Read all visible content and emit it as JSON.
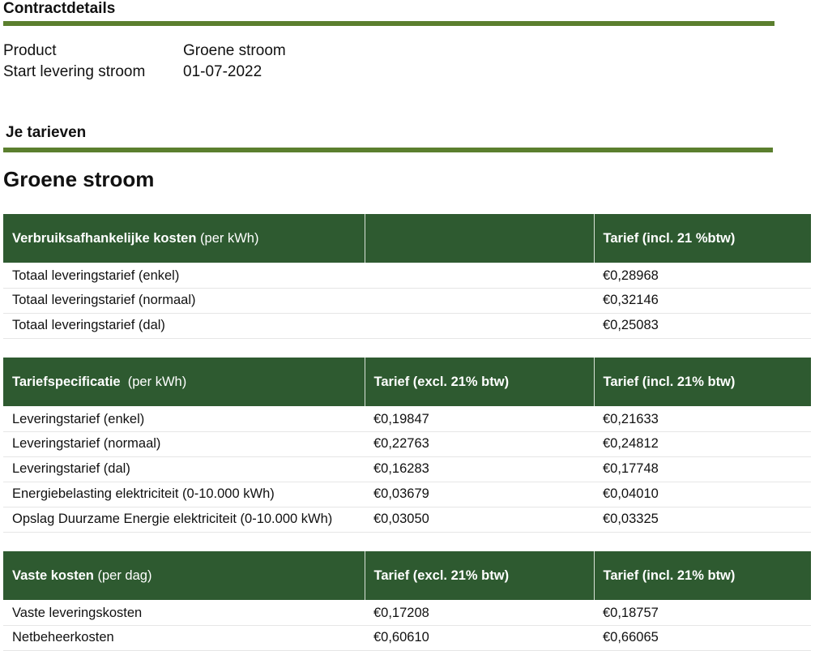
{
  "contract": {
    "title": "Contractdetails",
    "rows": [
      {
        "label": "Product",
        "value": "Groene stroom"
      },
      {
        "label": "Start levering stroom",
        "value": "01-07-2022"
      }
    ]
  },
  "tariffs": {
    "title": "Je tarieven",
    "product_title": "Groene stroom"
  },
  "usage_table": {
    "header_label": "Verbruiksafhankelijke kosten",
    "header_unit": "(per kWh)",
    "col2": "",
    "col3": "Tarief (incl. 21 %btw)",
    "rows": [
      {
        "label": "Totaal leveringstarief (enkel)",
        "excl": "",
        "incl": "€0,28968"
      },
      {
        "label": "Totaal leveringstarief (normaal)",
        "excl": "",
        "incl": "€0,32146"
      },
      {
        "label": "Totaal leveringstarief (dal)",
        "excl": "",
        "incl": "€0,25083"
      }
    ]
  },
  "spec_table": {
    "header_label": "Tariefspecificatie",
    "header_unit": "(per kWh)",
    "col2": "Tarief (excl. 21% btw)",
    "col3": "Tarief (incl. 21% btw)",
    "rows": [
      {
        "label": "Leveringstarief (enkel)",
        "excl": "€0,19847",
        "incl": "€0,21633"
      },
      {
        "label": "Leveringstarief (normaal)",
        "excl": "€0,22763",
        "incl": "€0,24812"
      },
      {
        "label": "Leveringstarief (dal)",
        "excl": "€0,16283",
        "incl": "€0,17748"
      },
      {
        "label": "Energiebelasting elektriciteit (0-10.000 kWh)",
        "excl": "€0,03679",
        "incl": "€0,04010"
      },
      {
        "label": "Opslag Duurzame Energie elektriciteit (0-10.000 kWh)",
        "excl": "€0,03050",
        "incl": "€0,03325"
      }
    ]
  },
  "fixed_table": {
    "header_label": "Vaste kosten",
    "header_unit": "(per dag)",
    "col2": "Tarief (excl. 21% btw)",
    "col3": "Tarief (incl. 21% btw)",
    "rows": [
      {
        "label": "Vaste leveringskosten",
        "excl": "€0,17208",
        "incl": "€0,18757"
      },
      {
        "label": "Netbeheerkosten",
        "excl": "€0,60610",
        "incl": "€0,66065"
      }
    ]
  },
  "colors": {
    "rule": "#5b7f2e",
    "table_header": "#2e5a30"
  }
}
